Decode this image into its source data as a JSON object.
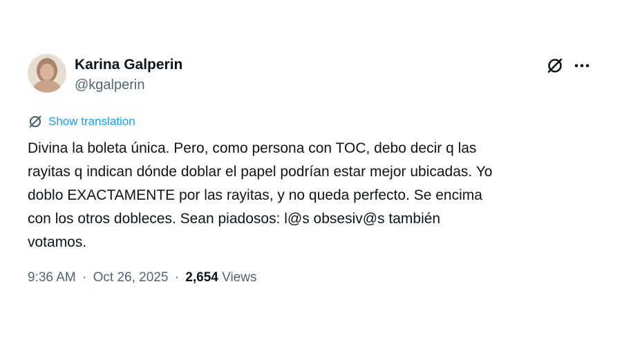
{
  "author": {
    "name": "Karina Galperin",
    "handle": "@kgalperin"
  },
  "header_actions": {
    "grok_icon": "grok-icon",
    "more_icon": "more-icon"
  },
  "translate": {
    "label": "Show translation",
    "icon": "translate-icon"
  },
  "tweet": {
    "lines": [
      "Divina la boleta única. Pero, como persona con TOC, debo decir q las",
      "rayitas q indican dónde doblar el papel podrían estar mejor ubicadas. Yo",
      "doblo EXACTAMENTE por las rayitas, y no queda perfecto. Se encima",
      "con los otros dobleces. Sean piadosos: l@s obsesiv@s también",
      "votamos."
    ]
  },
  "meta": {
    "time": "9:36 AM",
    "separator": "·",
    "date": "Oct 26, 2025",
    "views_count": "2,654",
    "views_label": "Views"
  },
  "colors": {
    "text": "#0f1419",
    "secondary": "#536471",
    "link": "#1d9bf0"
  }
}
